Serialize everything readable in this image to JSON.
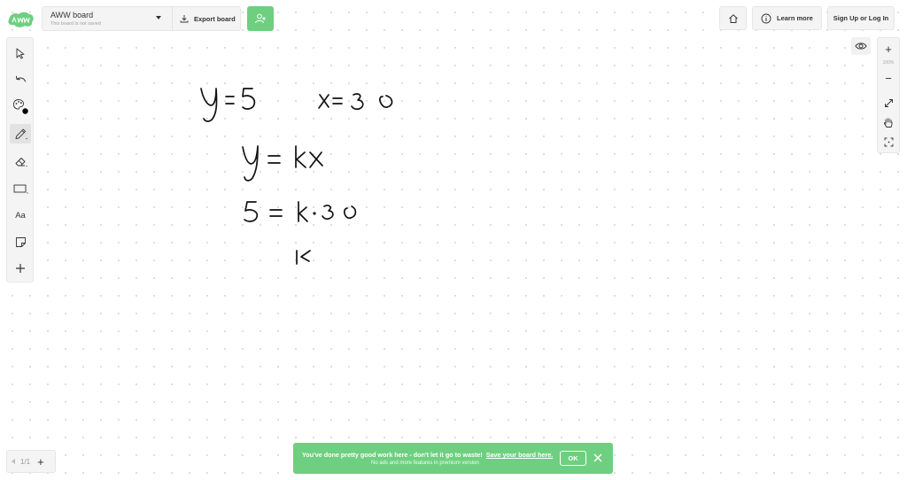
{
  "app": {
    "logo_text": "AWW"
  },
  "header": {
    "board_title": "AWW board",
    "board_status": "This board is not saved",
    "export_label": "Export board",
    "learn_more_label": "Learn more",
    "signup_label": "Sign Up or Log In"
  },
  "toolbar": {
    "tools": [
      "select-tool",
      "undo",
      "color-palette",
      "pencil-tool",
      "eraser-tool",
      "rectangle-tool",
      "text-tool",
      "sticky-note-tool",
      "add-tool"
    ],
    "text_tool_label": "Aa",
    "active_tool": "pencil-tool",
    "active_color": "#000000"
  },
  "zoom": {
    "level": "100%",
    "zoom_in_symbol": "+",
    "zoom_out_symbol": "−"
  },
  "pager": {
    "page_indicator": "1/1",
    "add_symbol": "+"
  },
  "banner": {
    "message": "You've done pretty good work here - don't let it go to waste!",
    "link_text": "Save your board here.",
    "sub_message": "No ads and more features in premium version",
    "ok_label": "OK"
  },
  "canvas": {
    "handwriting": [
      "y = 5",
      "x = 3 0",
      "y = kx",
      "5 = k · 3 0",
      "k"
    ]
  },
  "colors": {
    "brand_green": "#6fcf80",
    "panel_bg": "#f4f4f4",
    "ink": "#000000"
  }
}
